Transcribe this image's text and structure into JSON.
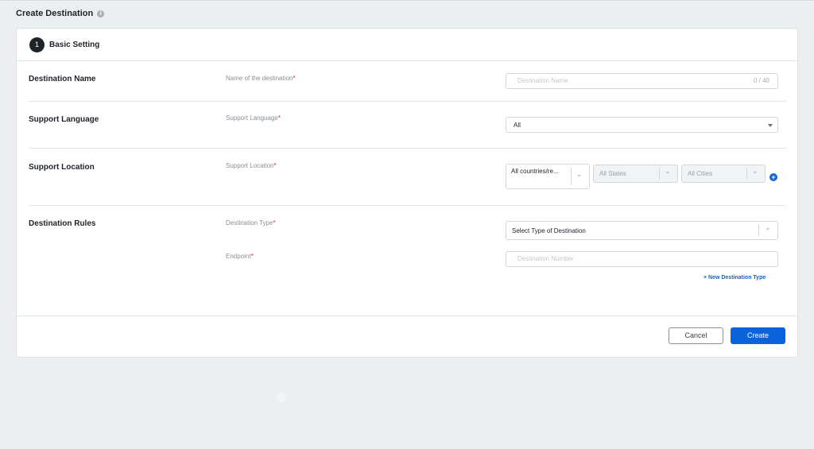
{
  "page": {
    "title": "Create Destination",
    "info_icon": "info-icon"
  },
  "step": {
    "number": "1",
    "title": "Basic Setting"
  },
  "rows": {
    "destination_name": {
      "label": "Destination Name",
      "field_label": "Name of the destination",
      "placeholder": "Destination Name",
      "counter": "0 / 40"
    },
    "support_language": {
      "label": "Support Language",
      "field_label": "Support Language",
      "value": "All"
    },
    "support_location": {
      "label": "Support Location",
      "field_label": "Support Location",
      "country_value": "All countries/re...",
      "state_value": "All States",
      "city_value": "All Cities",
      "add_icon": "plus-circle-icon"
    },
    "destination_rules": {
      "label": "Destination Rules",
      "type_label": "Destination Type",
      "type_placeholder": "Select Type of Destination",
      "endpoint_label": "Endpoint",
      "endpoint_placeholder": "Destination Number",
      "new_type_link": "+ New Destination Type"
    }
  },
  "required_marker": "*",
  "footer": {
    "cancel_label": "Cancel",
    "create_label": "Create"
  },
  "colors": {
    "primary": "#0b63dc",
    "required": "#e02424",
    "background": "#eceff0"
  }
}
